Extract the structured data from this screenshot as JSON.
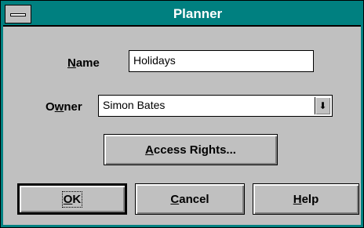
{
  "window": {
    "title": "Planner"
  },
  "form": {
    "name": {
      "label_accel": "N",
      "label_rest": "ame",
      "value": "Holidays"
    },
    "owner": {
      "label_pre": "O",
      "label_accel": "w",
      "label_rest": "ner",
      "value": "Simon Bates",
      "arrow_glyph": "⬇"
    }
  },
  "buttons": {
    "access_rights": {
      "accel": "A",
      "rest": "ccess Rights..."
    },
    "ok": {
      "accel": "O",
      "rest": "K"
    },
    "cancel": {
      "accel": "C",
      "rest": "ancel"
    },
    "help": {
      "accel": "H",
      "rest": "elp"
    }
  },
  "colors": {
    "titlebar": "#008080",
    "face": "#c0c0c0"
  }
}
